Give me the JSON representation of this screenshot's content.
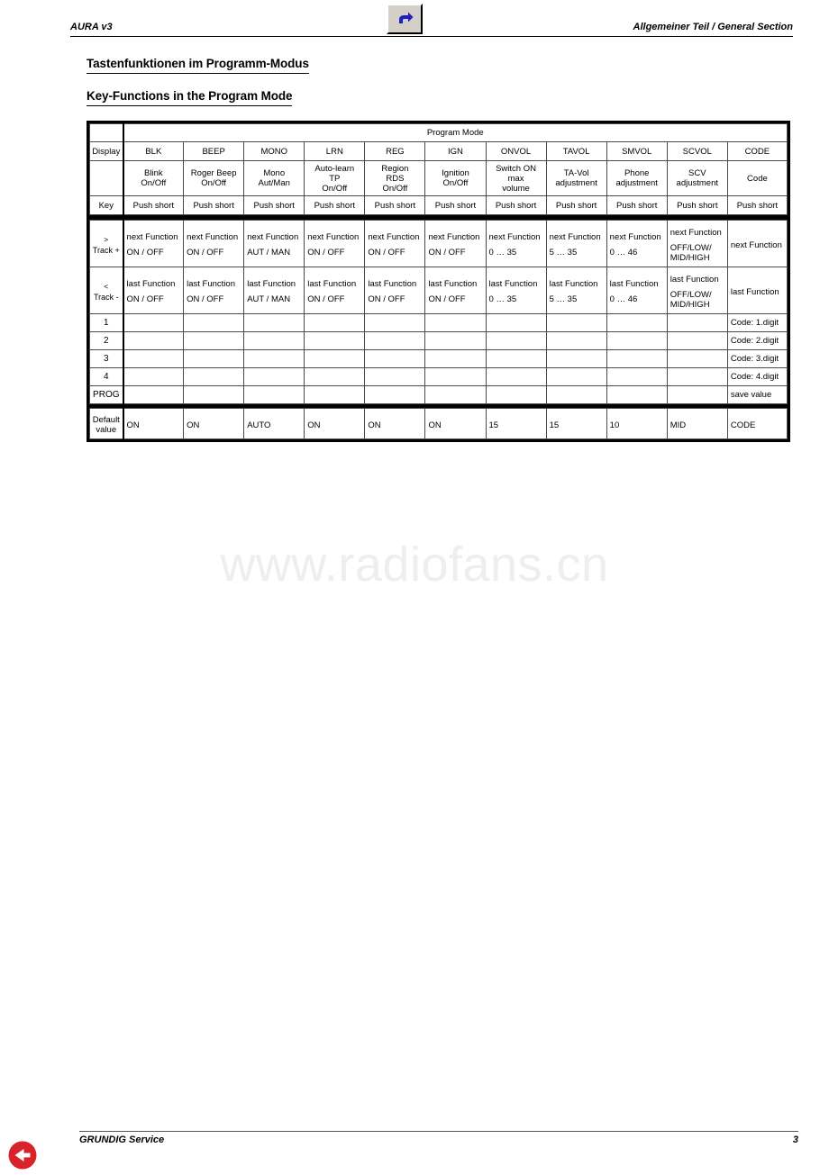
{
  "header": {
    "left_label": "AURA v3",
    "right_label": "Allgemeiner Teil / General Section",
    "icon": "back-arrow-icon"
  },
  "titles": {
    "german": "Tastenfunktionen im Programm-Modus",
    "english": "Key-Functions in the Program Mode"
  },
  "table": {
    "span_title": "Program Mode",
    "row_display_label": "Display",
    "row_key_label": "Key",
    "columns": [
      {
        "display": "BLK",
        "description": "Blink\nOn/Off",
        "key": "Push short",
        "next": "next Function",
        "next_value": "ON / OFF",
        "last": "last Function",
        "last_value": "ON / OFF",
        "digit1": "",
        "digit2": "",
        "digit3": "",
        "digit4": "",
        "prog": "",
        "default": "ON"
      },
      {
        "display": "BEEP",
        "description": "Roger Beep\nOn/Off",
        "key": "Push short",
        "next": "next Function",
        "next_value": "ON / OFF",
        "last": "last Function",
        "last_value": "ON / OFF",
        "digit1": "",
        "digit2": "",
        "digit3": "",
        "digit4": "",
        "prog": "",
        "default": "ON"
      },
      {
        "display": "MONO",
        "description": "Mono\nAut/Man",
        "key": "Push short",
        "next": "next Function",
        "next_value": "AUT / MAN",
        "last": "last Function",
        "last_value": "AUT / MAN",
        "digit1": "",
        "digit2": "",
        "digit3": "",
        "digit4": "",
        "prog": "",
        "default": "AUTO"
      },
      {
        "display": "LRN",
        "description": "Auto-learn\nTP\nOn/Off",
        "key": "Push short",
        "next": "next Function",
        "next_value": "ON / OFF",
        "last": "last Function",
        "last_value": "ON / OFF",
        "digit1": "",
        "digit2": "",
        "digit3": "",
        "digit4": "",
        "prog": "",
        "default": "ON"
      },
      {
        "display": "REG",
        "description": "Region\nRDS\nOn/Off",
        "key": "Push short",
        "next": "next Function",
        "next_value": "ON / OFF",
        "last": "last Function",
        "last_value": "ON / OFF",
        "digit1": "",
        "digit2": "",
        "digit3": "",
        "digit4": "",
        "prog": "",
        "default": "ON"
      },
      {
        "display": "IGN",
        "description": "Ignition\nOn/Off",
        "key": "Push short",
        "next": "next Function",
        "next_value": "ON / OFF",
        "last": "last Function",
        "last_value": "ON / OFF",
        "digit1": "",
        "digit2": "",
        "digit3": "",
        "digit4": "",
        "prog": "",
        "default": "ON"
      },
      {
        "display": "ONVOL",
        "description": "Switch ON\nmax\nvolume",
        "key": "Push short",
        "next": "next Function",
        "next_value": "0 … 35",
        "last": "last Function",
        "last_value": "0 … 35",
        "digit1": "",
        "digit2": "",
        "digit3": "",
        "digit4": "",
        "prog": "",
        "default": "15"
      },
      {
        "display": "TAVOL",
        "description": "TA-Vol\nadjustment",
        "key": "Push short",
        "next": "next Function",
        "next_value": "5 … 35",
        "last": "last Function",
        "last_value": "5 … 35",
        "digit1": "",
        "digit2": "",
        "digit3": "",
        "digit4": "",
        "prog": "",
        "default": "15"
      },
      {
        "display": "SMVOL",
        "description": "Phone\nadjustment",
        "key": "Push short",
        "next": "next Function",
        "next_value": "0 … 46",
        "last": "last Function",
        "last_value": "0 … 46",
        "digit1": "",
        "digit2": "",
        "digit3": "",
        "digit4": "",
        "prog": "",
        "default": "10"
      },
      {
        "display": "SCVOL",
        "description": "SCV\nadjustment",
        "key": "Push short",
        "next": "next Function",
        "next_value": "OFF/LOW/\nMID/HIGH",
        "last": "last Function",
        "last_value": "OFF/LOW/\nMID/HIGH",
        "digit1": "",
        "digit2": "",
        "digit3": "",
        "digit4": "",
        "prog": "",
        "default": "MID"
      },
      {
        "display": "CODE",
        "description": "Code",
        "key": "Push short",
        "next": "next Function",
        "next_value": "",
        "last": "last Function",
        "last_value": "",
        "digit1": "Code: 1.digit",
        "digit2": "Code: 2.digit",
        "digit3": "Code: 3.digit",
        "digit4": "Code: 4.digit",
        "prog": "save value",
        "default": "CODE"
      }
    ],
    "row_labels": {
      "next_symbol": ">",
      "next_track": "Track +",
      "last_symbol": "<",
      "last_track": "Track -",
      "n1": "1",
      "n2": "2",
      "n3": "3",
      "n4": "4",
      "prog": "PROG",
      "default_line1": "Default",
      "default_line2": "value"
    }
  },
  "watermark": "www.radiofans.cn",
  "footer": {
    "left_label": "GRUNDIG Service",
    "page_number": "3",
    "back_icon": "back-arrow-circle-icon"
  },
  "colors": {
    "text": "#000000",
    "grid": "#4a4a4a",
    "frame": "#000000",
    "watermark": "#eeeeee",
    "accent_blue": "#2020c0",
    "accent_red": "#d9232a"
  }
}
